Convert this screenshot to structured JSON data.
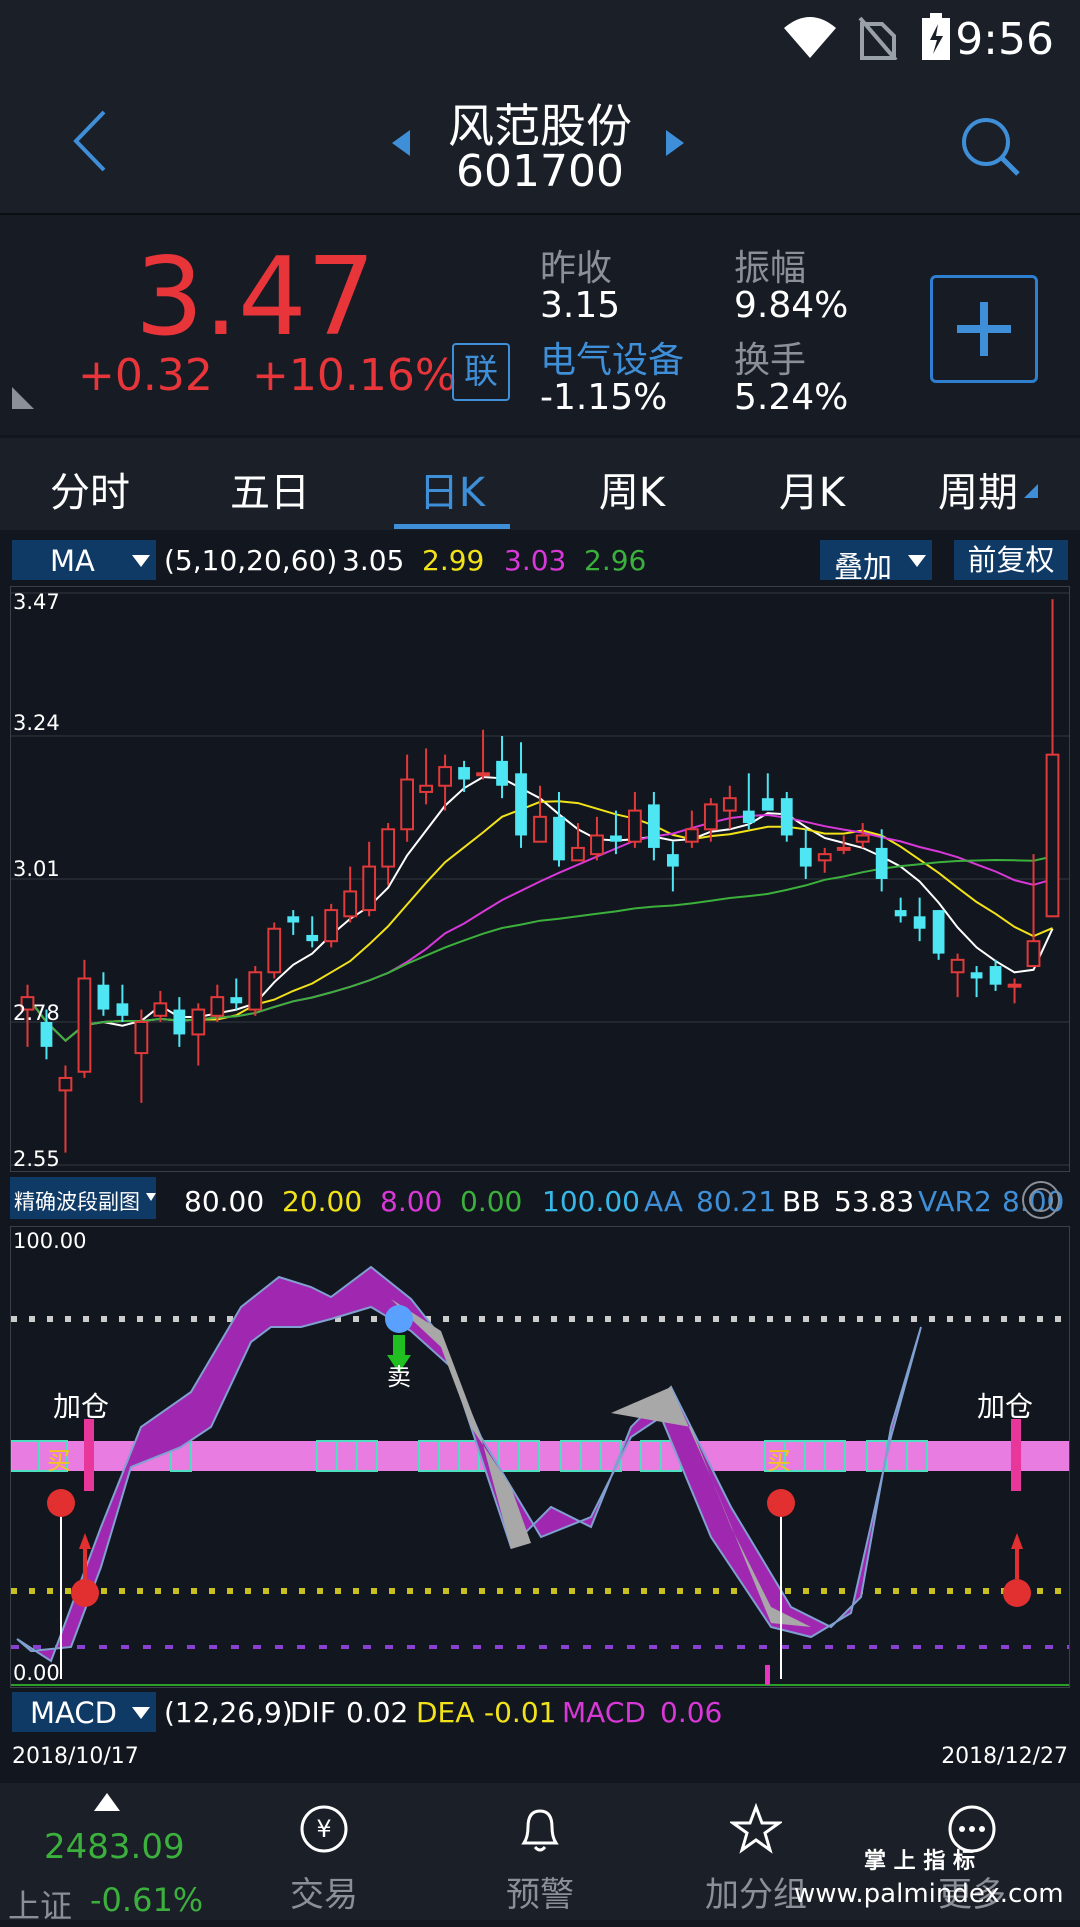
{
  "status": {
    "time": "9:56"
  },
  "header": {
    "stock_name": "风范股份",
    "stock_code": "601700"
  },
  "quote": {
    "price": "3.47",
    "change": "+0.32",
    "change_pct": "+10.16%",
    "link_label": "联",
    "prev_close_label": "昨收",
    "prev_close": "3.15",
    "amplitude_label": "振幅",
    "amplitude": "9.84%",
    "sector": "电气设备",
    "sector_change": "-1.15%",
    "turnover_label": "换手",
    "turnover": "5.24%"
  },
  "tabs": [
    {
      "label": "分时"
    },
    {
      "label": "五日"
    },
    {
      "label": "日K"
    },
    {
      "label": "周K"
    },
    {
      "label": "月K"
    },
    {
      "label": "周期"
    }
  ],
  "ma_bar": {
    "selector": "MA",
    "params": "(5,10,20,60)",
    "ma5": "3.05",
    "ma10": "2.99",
    "ma20": "3.03",
    "ma60": "2.96",
    "overlay": "叠加",
    "adjust": "前复权"
  },
  "ind_bar": {
    "selector": "精确波段副图",
    "v1": "80.00",
    "v2": "20.00",
    "v3": "8.00",
    "v4": "0.00",
    "v5": "100.00",
    "aa_label": "AA",
    "aa": "80.21",
    "bb_label": "BB",
    "bb": "53.83",
    "var2_label": "VAR2",
    "var2": "8.00"
  },
  "sub_chart": {
    "top": "100.00",
    "bottom": "0.00",
    "add_label_left": "加仓",
    "add_label_right": "加仓",
    "buy_left": "买",
    "buy_right": "买",
    "sell": "卖"
  },
  "macd_bar": {
    "selector": "MACD",
    "params": "(12,26,9)",
    "dif_label": "DIF",
    "dif": "0.02",
    "dea_label": "DEA",
    "dea": "-0.01",
    "macd_label": "MACD",
    "macd": "0.06"
  },
  "dates": {
    "start": "2018/10/17",
    "end": "2018/12/27"
  },
  "bottom_nav": {
    "index_value": "2483.09",
    "index_name": "上证",
    "index_change": "-0.61%",
    "trade": "交易",
    "alert": "预警",
    "group": "加分组",
    "more": "更多",
    "watermark_cn": "掌 上 指 标",
    "watermark_url": "www.palmindex.com"
  },
  "chart_data": {
    "type": "candlestick",
    "ylim": [
      2.55,
      3.47
    ],
    "yticks": [
      "3.47",
      "3.24",
      "3.01",
      "2.78",
      "2.55"
    ],
    "candles": [
      [
        2.8,
        2.82,
        2.84,
        2.74
      ],
      [
        2.78,
        2.74,
        2.8,
        2.72
      ],
      [
        2.67,
        2.69,
        2.71,
        2.57
      ],
      [
        2.7,
        2.85,
        2.88,
        2.69
      ],
      [
        2.84,
        2.8,
        2.86,
        2.79
      ],
      [
        2.81,
        2.79,
        2.84,
        2.78
      ],
      [
        2.73,
        2.78,
        2.8,
        2.65
      ],
      [
        2.79,
        2.81,
        2.83,
        2.78
      ],
      [
        2.8,
        2.76,
        2.82,
        2.74
      ],
      [
        2.76,
        2.8,
        2.81,
        2.71
      ],
      [
        2.79,
        2.82,
        2.84,
        2.78
      ],
      [
        2.82,
        2.81,
        2.85,
        2.8
      ],
      [
        2.8,
        2.86,
        2.87,
        2.79
      ],
      [
        2.86,
        2.93,
        2.94,
        2.85
      ],
      [
        2.95,
        2.94,
        2.96,
        2.92
      ],
      [
        2.92,
        2.91,
        2.95,
        2.9
      ],
      [
        2.91,
        2.96,
        2.97,
        2.9
      ],
      [
        2.95,
        2.99,
        3.03,
        2.94
      ],
      [
        2.96,
        3.03,
        3.07,
        2.95
      ],
      [
        3.03,
        3.09,
        3.1,
        3.0
      ],
      [
        3.09,
        3.17,
        3.21,
        3.07
      ],
      [
        3.15,
        3.16,
        3.22,
        3.13
      ],
      [
        3.16,
        3.19,
        3.21,
        3.12
      ],
      [
        3.19,
        3.17,
        3.2,
        3.15
      ],
      [
        3.18,
        3.18,
        3.25,
        3.17
      ],
      [
        3.2,
        3.16,
        3.24,
        3.14
      ],
      [
        3.18,
        3.08,
        3.23,
        3.06
      ],
      [
        3.07,
        3.11,
        3.16,
        3.07
      ],
      [
        3.11,
        3.04,
        3.15,
        3.03
      ],
      [
        3.04,
        3.06,
        3.1,
        3.04
      ],
      [
        3.05,
        3.08,
        3.11,
        3.04
      ],
      [
        3.08,
        3.07,
        3.12,
        3.05
      ],
      [
        3.07,
        3.12,
        3.15,
        3.06
      ],
      [
        3.13,
        3.06,
        3.15,
        3.04
      ],
      [
        3.05,
        3.03,
        3.07,
        2.99
      ],
      [
        3.07,
        3.09,
        3.12,
        3.06
      ],
      [
        3.09,
        3.13,
        3.14,
        3.07
      ],
      [
        3.12,
        3.14,
        3.16,
        3.09
      ],
      [
        3.12,
        3.1,
        3.18,
        3.09
      ],
      [
        3.14,
        3.12,
        3.18,
        3.12
      ],
      [
        3.14,
        3.08,
        3.15,
        3.07
      ],
      [
        3.06,
        3.03,
        3.09,
        3.01
      ],
      [
        3.04,
        3.05,
        3.06,
        3.02
      ],
      [
        3.06,
        3.06,
        3.08,
        3.05
      ],
      [
        3.07,
        3.08,
        3.1,
        3.06
      ],
      [
        3.06,
        3.01,
        3.09,
        2.99
      ],
      [
        2.96,
        2.95,
        2.98,
        2.94
      ],
      [
        2.95,
        2.93,
        2.98,
        2.91
      ],
      [
        2.96,
        2.89,
        2.96,
        2.88
      ],
      [
        2.86,
        2.88,
        2.89,
        2.82
      ],
      [
        2.86,
        2.85,
        2.87,
        2.82
      ],
      [
        2.87,
        2.84,
        2.88,
        2.83
      ],
      [
        2.84,
        2.84,
        2.85,
        2.81
      ],
      [
        2.87,
        2.91,
        3.05,
        2.88
      ],
      [
        2.95,
        3.21,
        3.46,
        2.96
      ]
    ]
  }
}
